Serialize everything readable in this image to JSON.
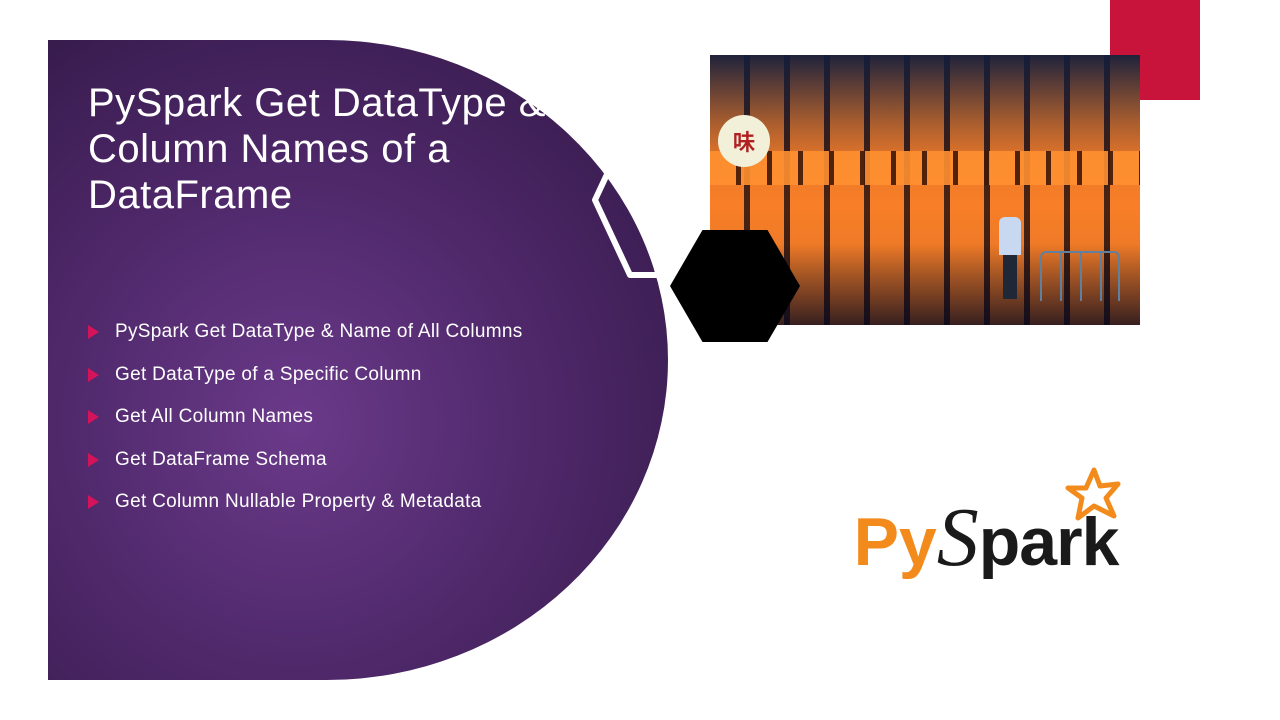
{
  "slide": {
    "title": "PySpark Get DataType & Column Names of a DataFrame",
    "bullets": [
      "PySpark Get DataType & Name of All Columns",
      "Get DataType of a Specific Column",
      "Get All Column Names",
      "Get DataFrame Schema",
      "Get Column Nullable Property & Metadata"
    ]
  },
  "logo": {
    "py": "Py",
    "s": "S",
    "park": "park"
  },
  "colors": {
    "accent": "#c8133b",
    "bullet_triangle": "#d4145a",
    "logo_orange": "#f28b1c"
  }
}
